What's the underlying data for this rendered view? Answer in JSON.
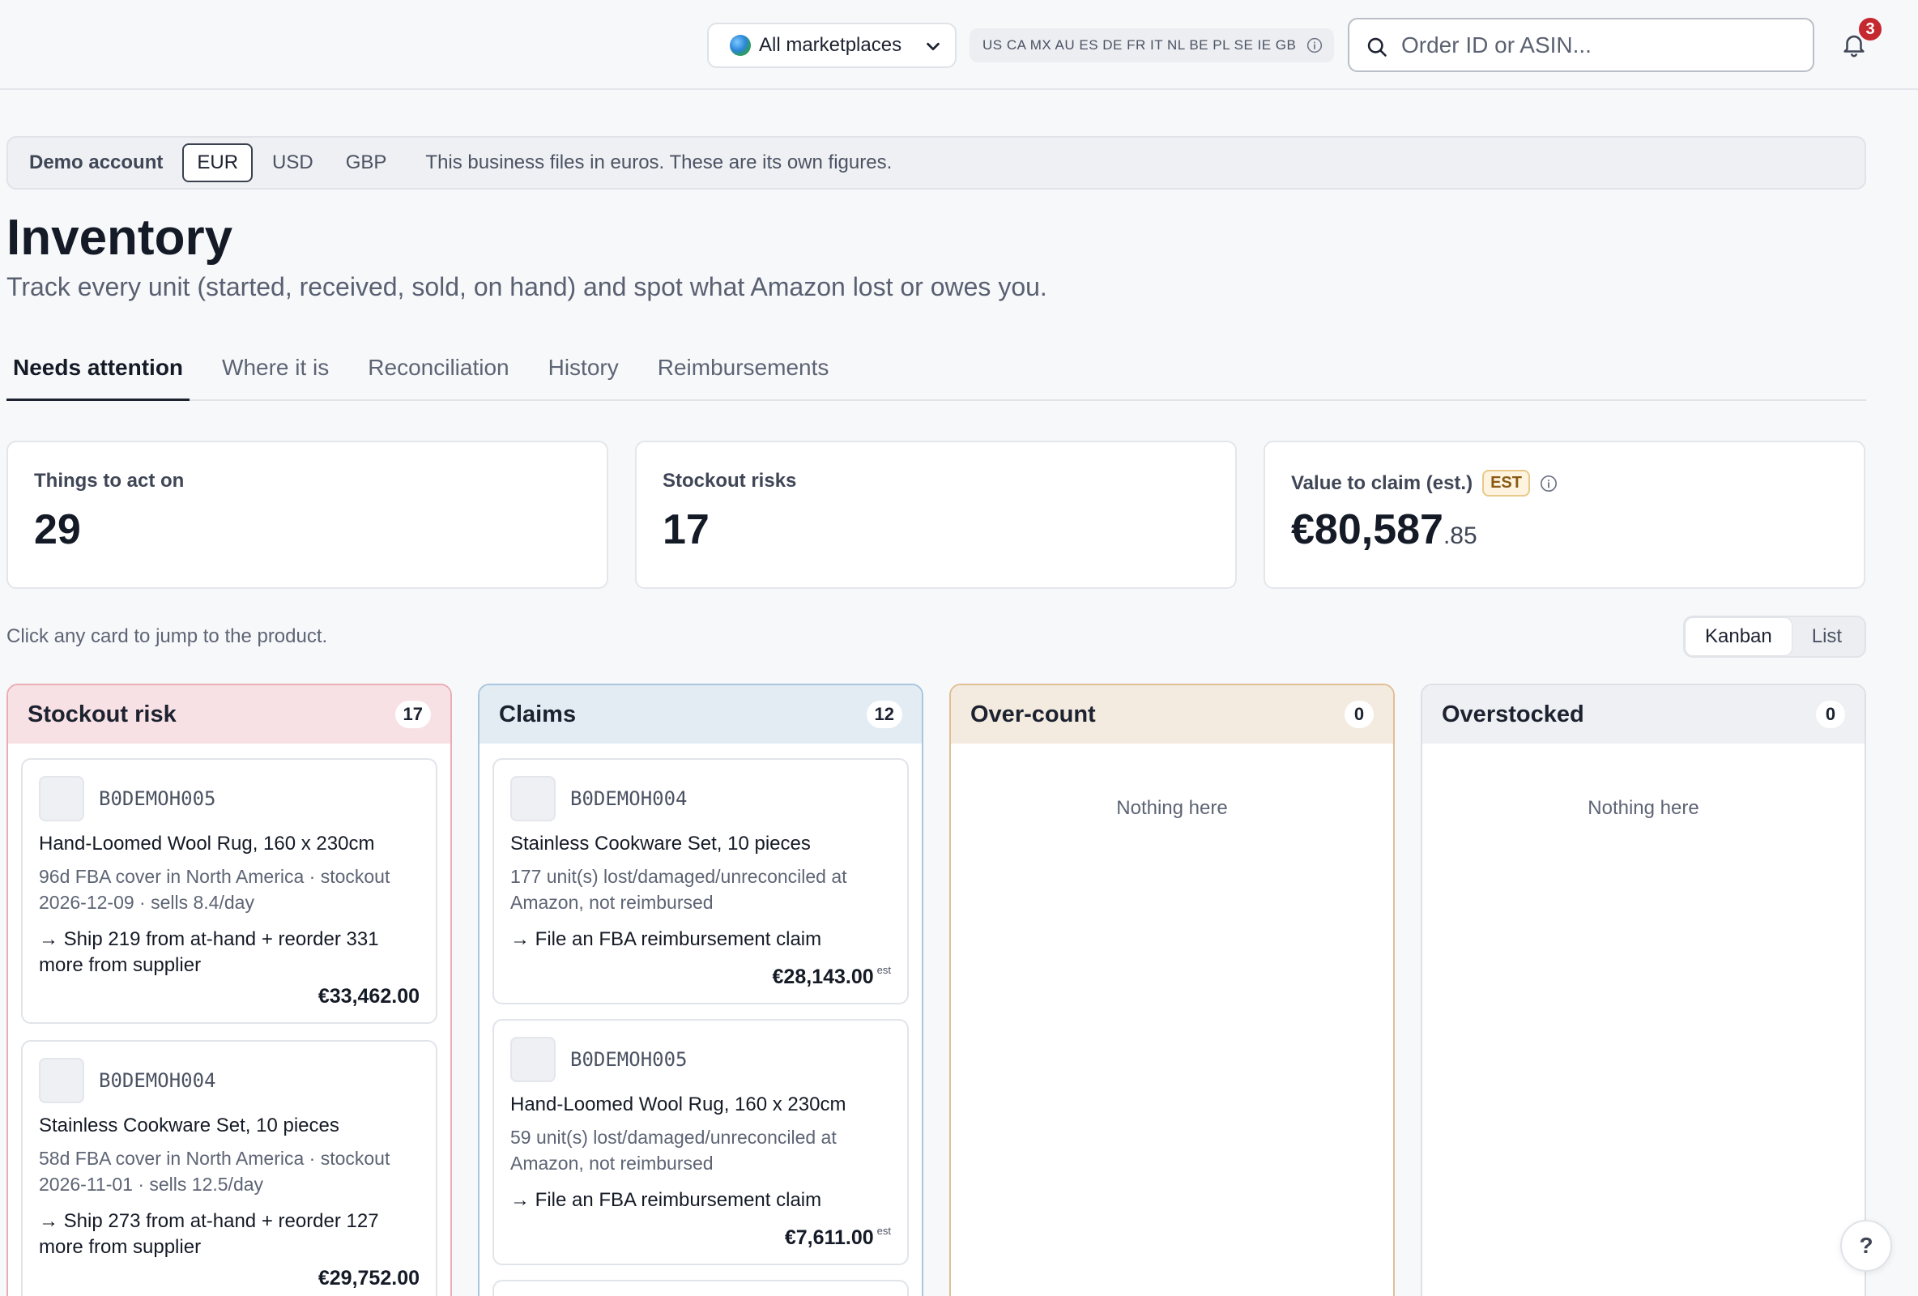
{
  "topbar": {
    "marketplace_select": "All marketplaces",
    "marketplace_codes": "US CA MX AU ES DE FR IT NL BE PL SE IE GB",
    "search_placeholder": "Order ID or ASIN...",
    "notification_count": "3"
  },
  "account_bar": {
    "label": "Demo account",
    "currencies": [
      "EUR",
      "USD",
      "GBP"
    ],
    "active_currency": "EUR",
    "note": "This business files in euros. These are its own figures."
  },
  "page": {
    "title": "Inventory",
    "subtitle": "Track every unit (started, received, sold, on hand) and spot what Amazon lost or owes you."
  },
  "tabs": [
    {
      "label": "Needs attention",
      "active": true
    },
    {
      "label": "Where it is",
      "active": false
    },
    {
      "label": "Reconciliation",
      "active": false
    },
    {
      "label": "History",
      "active": false
    },
    {
      "label": "Reimbursements",
      "active": false
    }
  ],
  "stats": {
    "things_label": "Things to act on",
    "things_value": "29",
    "stockout_label": "Stockout risks",
    "stockout_value": "17",
    "claim_label": "Value to claim (est.)",
    "claim_badge": "EST",
    "claim_value_main": "€80,587",
    "claim_value_cents": ".85"
  },
  "hint": "Click any card to jump to the product.",
  "view_toggle": {
    "kanban": "Kanban",
    "list": "List",
    "active": "Kanban"
  },
  "columns": {
    "stockout": {
      "title": "Stockout risk",
      "count": "17",
      "cards": [
        {
          "asin": "B0DEMOH005",
          "name": "Hand-Loomed Wool Rug, 160 x 230cm",
          "desc": "96d FBA cover in North America · stockout 2026-12-09 · sells 8.4/day",
          "action": "→ Ship 219 from at-hand + reorder 331 more from supplier",
          "amount": "€33,462.00"
        },
        {
          "asin": "B0DEMOH004",
          "name": "Stainless Cookware Set, 10 pieces",
          "desc": "58d FBA cover in North America · stockout 2026-11-01 · sells 12.5/day",
          "action": "→ Ship 273 from at-hand + reorder 127 more from supplier",
          "amount": "€29,752.00"
        }
      ]
    },
    "claims": {
      "title": "Claims",
      "count": "12",
      "cards": [
        {
          "asin": "B0DEMOH004",
          "name": "Stainless Cookware Set, 10 pieces",
          "desc": "177 unit(s) lost/damaged/unreconciled at Amazon, not reimbursed",
          "action": "→ File an FBA reimbursement claim",
          "amount": "€28,143.00",
          "est": "est"
        },
        {
          "asin": "B0DEMOH005",
          "name": "Hand-Loomed Wool Rug, 160 x 230cm",
          "desc": "59 unit(s) lost/damaged/unreconciled at Amazon, not reimbursed",
          "action": "→ File an FBA reimbursement claim",
          "amount": "€7,611.00",
          "est": "est"
        }
      ]
    },
    "overcount": {
      "title": "Over-count",
      "count": "0",
      "empty": "Nothing here"
    },
    "overstocked": {
      "title": "Overstocked",
      "count": "0",
      "empty": "Nothing here"
    }
  },
  "help_label": "?",
  "colors": {
    "stockout_head": "#f8e1e4",
    "stockout_border": "#e8aeb5",
    "claims_head": "#e3ecf3",
    "claims_border": "#a9c6de",
    "overcount_head": "#f4ebe0",
    "overcount_border": "#e1bf95",
    "overstocked_head": "#eef0f3",
    "overstocked_border": "#dde0e6"
  }
}
